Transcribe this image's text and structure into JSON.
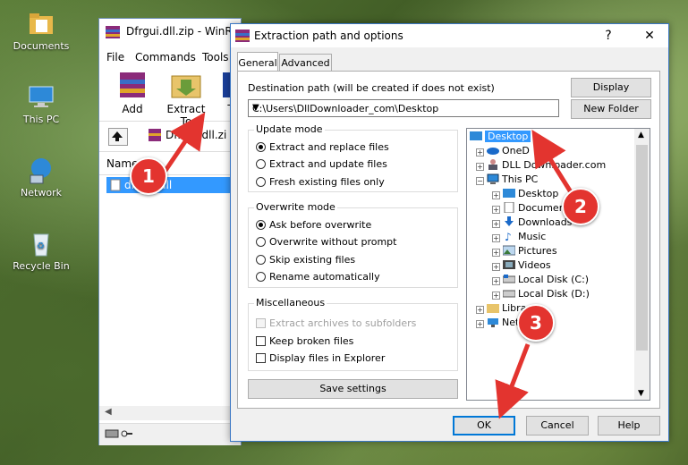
{
  "desktop": {
    "icons": [
      {
        "label": "Documents"
      },
      {
        "label": "This PC"
      },
      {
        "label": "Network"
      },
      {
        "label": "Recycle Bin"
      }
    ]
  },
  "winrar": {
    "title": "Dfrgui.dll.zip - WinRA",
    "menu": [
      "File",
      "Commands",
      "Tools"
    ],
    "toolbar": {
      "add": "Add",
      "extract_to": "Extract To",
      "extra": "T"
    },
    "path": "Dfrgui.dll.zi",
    "column_name": "Name",
    "selected_file": "dfrgui.dll"
  },
  "dialog": {
    "title": "Extraction path and options",
    "help_glyph": "?",
    "close_glyph": "✕",
    "tabs": [
      "General",
      "Advanced"
    ],
    "destination_label": "Destination path (will be created if does not exist)",
    "destination_value": "C:\\Users\\DllDownloader_com\\Desktop",
    "display_button": "Display",
    "new_folder_button": "New Folder",
    "update_mode": {
      "title": "Update mode",
      "options": [
        "Extract and replace files",
        "Extract and update files",
        "Fresh existing files only"
      ],
      "selected": 0
    },
    "overwrite_mode": {
      "title": "Overwrite mode",
      "options": [
        "Ask before overwrite",
        "Overwrite without prompt",
        "Skip existing files",
        "Rename automatically"
      ],
      "selected": 0
    },
    "misc": {
      "title": "Miscellaneous",
      "options": [
        "Extract archives to subfolders",
        "Keep broken files",
        "Display files in Explorer"
      ]
    },
    "save_settings": "Save settings",
    "tree": [
      {
        "label": "Desktop",
        "selected": true
      },
      {
        "label": "OneD"
      },
      {
        "label": "DLL Downloader.com"
      },
      {
        "label": "This PC"
      },
      {
        "label": "Desktop"
      },
      {
        "label": "Documen"
      },
      {
        "label": "Downloads"
      },
      {
        "label": "Music"
      },
      {
        "label": "Pictures"
      },
      {
        "label": "Videos"
      },
      {
        "label": "Local Disk (C:)"
      },
      {
        "label": "Local Disk (D:)"
      },
      {
        "label": "Libra"
      },
      {
        "label": "Net"
      }
    ],
    "ok": "OK",
    "cancel": "Cancel",
    "help": "Help"
  },
  "markers": [
    "1",
    "2",
    "3"
  ],
  "colors": {
    "marker": "#e3342f",
    "selection": "#3399ff",
    "accent": "#0078d7"
  }
}
